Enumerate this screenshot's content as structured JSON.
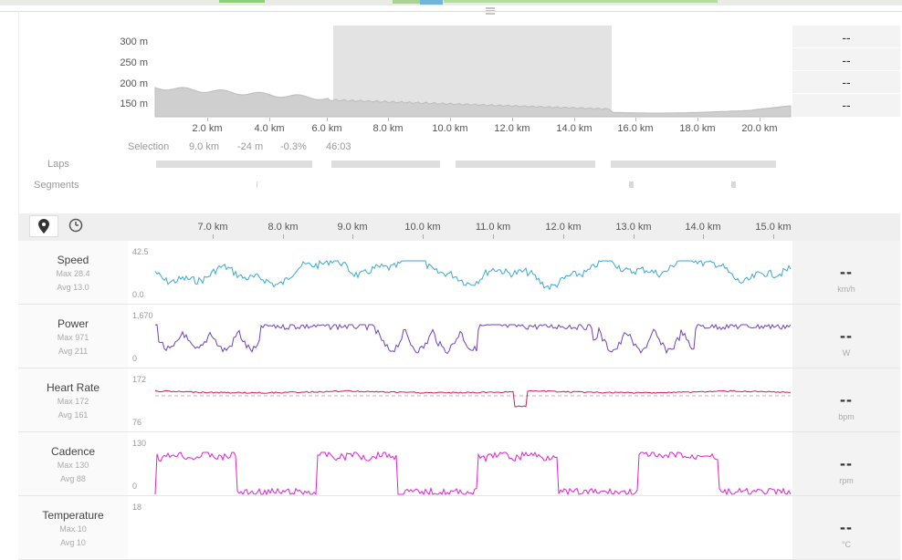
{
  "map_strip": {
    "handle_icon": "drag-handle-icon"
  },
  "elevation": {
    "y_ticks": [
      "300 m",
      "250 m",
      "200 m",
      "150 m"
    ],
    "x_ticks": [
      "2.0 km",
      "4.0 km",
      "6.0 km",
      "8.0 km",
      "10.0 km",
      "12.0 km",
      "14.0 km",
      "16.0 km",
      "18.0 km",
      "20.0 km"
    ],
    "selection": {
      "label": "Selection",
      "distance": "9.0 km",
      "elev_change": "-24 m",
      "grade": "-0.3%",
      "time": "46:03"
    },
    "selection_range_km": [
      5.7,
      14.7
    ],
    "side_values": [
      "--",
      "--",
      "--",
      "--"
    ]
  },
  "laps": {
    "label": "Laps"
  },
  "segments": {
    "label": "Segments"
  },
  "detail_axis": {
    "icons": [
      "location-pin-icon",
      "clock-icon"
    ],
    "x_ticks": [
      "7.0 km",
      "8.0 km",
      "9.0 km",
      "10.0 km",
      "11.0 km",
      "12.0 km",
      "13.0 km",
      "14.0 km",
      "15.0 km"
    ]
  },
  "metrics": [
    {
      "name": "Speed",
      "max": "Max 28.4",
      "avg": "Avg 13.0",
      "top": "42.5",
      "bottom": "0.0",
      "value": "--",
      "unit": "km/h",
      "color": "#3ba9cf"
    },
    {
      "name": "Power",
      "max": "Max 971",
      "avg": "Avg 211",
      "top": "1,670",
      "bottom": "0",
      "value": "--",
      "unit": "W",
      "color": "#7040c0"
    },
    {
      "name": "Heart Rate",
      "max": "Max 172",
      "avg": "Avg 161",
      "top": "172",
      "bottom": "76",
      "value": "--",
      "unit": "bpm",
      "color": "#c8205a"
    },
    {
      "name": "Cadence",
      "max": "Max 130",
      "avg": "Avg 88",
      "top": "130",
      "bottom": "0",
      "value": "--",
      "unit": "rpm",
      "color": "#e020d8"
    },
    {
      "name": "Temperature",
      "max": "Max 10",
      "avg": "Avg 10",
      "top": "18",
      "bottom": "",
      "value": "--",
      "unit": "°C",
      "color": "#888888"
    }
  ]
}
